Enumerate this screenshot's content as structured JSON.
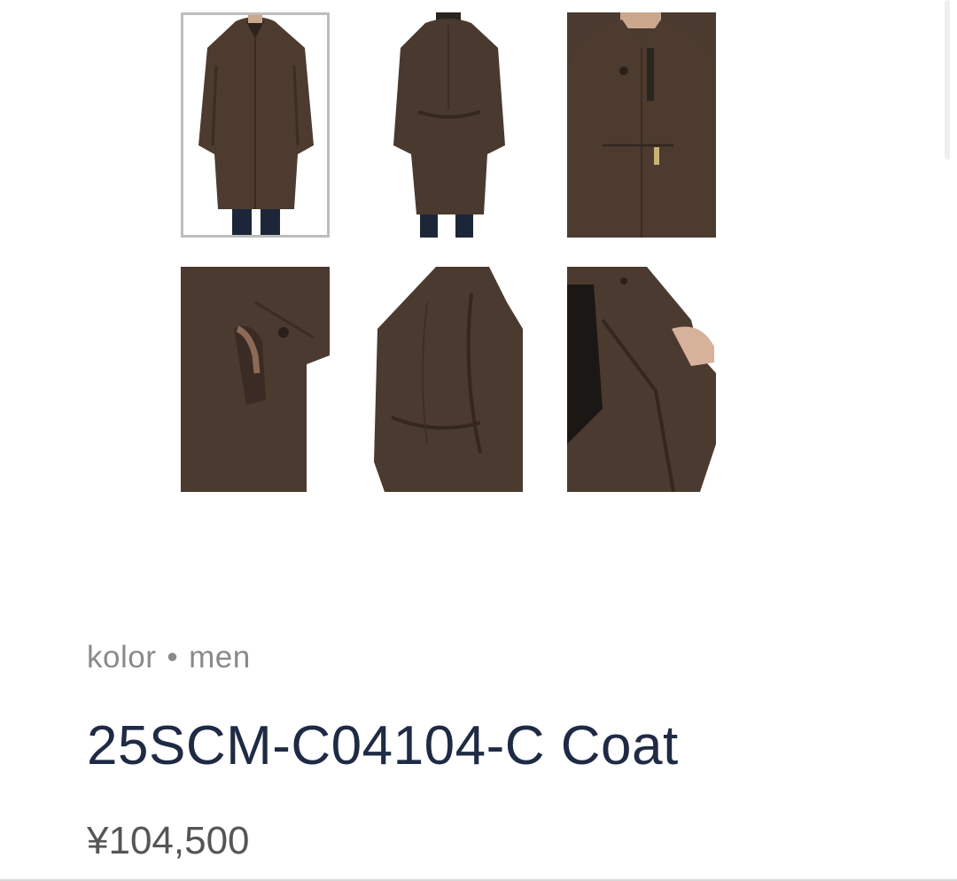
{
  "gallery": {
    "images": [
      {
        "name": "front-view",
        "selected": true
      },
      {
        "name": "back-view",
        "selected": false
      },
      {
        "name": "collar-detail",
        "selected": false
      },
      {
        "name": "pocket-detail",
        "selected": false
      },
      {
        "name": "shoulder-detail",
        "selected": false
      },
      {
        "name": "interior-detail",
        "selected": false
      }
    ]
  },
  "product": {
    "brand": "kolor",
    "separator": "•",
    "category": "men",
    "title": "25SCM-C04104-C Coat",
    "price": "¥104,500"
  },
  "colors": {
    "title": "#1f2a44",
    "brand": "#8a8a8a",
    "price": "#555555",
    "coat": "#4a3a30"
  }
}
